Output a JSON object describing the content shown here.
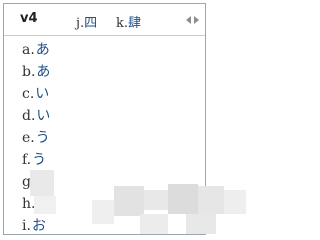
{
  "composition": {
    "text": "v4"
  },
  "top_candidates": [
    {
      "key": "j.",
      "glyph": "四"
    },
    {
      "key": "k.",
      "glyph": "肆"
    }
  ],
  "candidates": [
    {
      "key": "a.",
      "glyph": "あ"
    },
    {
      "key": "b.",
      "glyph": "あ"
    },
    {
      "key": "c.",
      "glyph": "い"
    },
    {
      "key": "d.",
      "glyph": "い"
    },
    {
      "key": "e.",
      "glyph": "う"
    },
    {
      "key": "f.",
      "glyph": "う"
    },
    {
      "key": "g",
      "glyph": ""
    },
    {
      "key": "h.",
      "glyph": ""
    },
    {
      "key": "i.",
      "glyph": "お"
    }
  ],
  "icons": {
    "prev_page": "triangle-left-icon",
    "next_page": "triangle-right-icon"
  },
  "colors": {
    "border": "#9aa6b2",
    "glyph": "#1f4e8c",
    "arrow": "#8a8f96"
  }
}
